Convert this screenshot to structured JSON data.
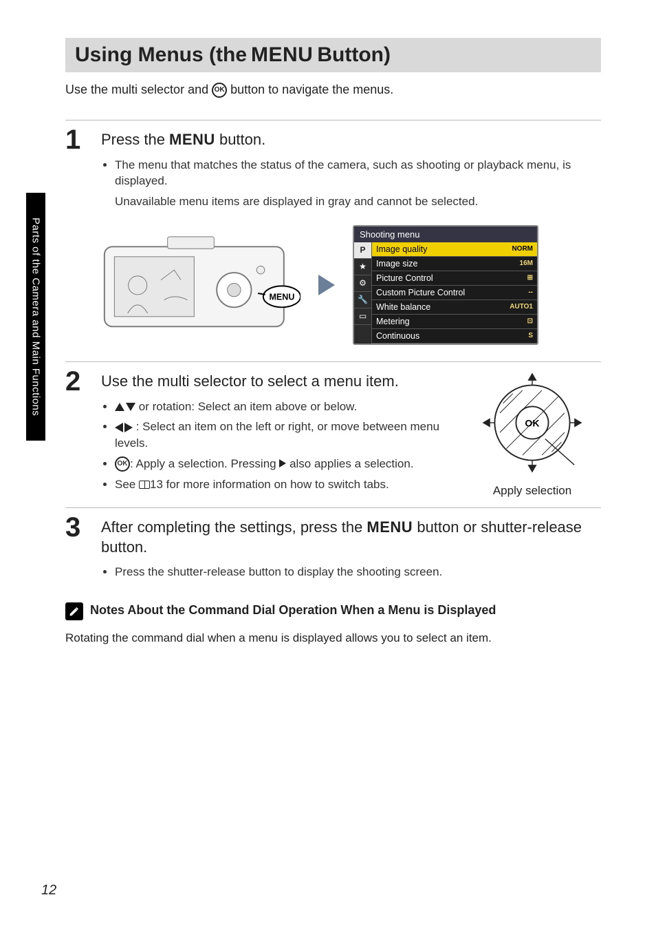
{
  "sideTabLabel": "Parts of the Camera and Main Functions",
  "pageNumber": "12",
  "heading": {
    "pre": "Using Menus (the ",
    "menuWord": "MENU",
    "post": " Button)"
  },
  "intro": {
    "pre": "Use the multi selector and ",
    "ok": "OK",
    "post": " button to navigate the menus."
  },
  "step1": {
    "num": "1",
    "title": {
      "pre": "Press the ",
      "menuWord": "MENU",
      "post": " button."
    },
    "bullets": [
      "The menu that matches the status of the camera, such as shooting or playback menu, is displayed.",
      "Unavailable menu items are displayed in gray and cannot be selected."
    ],
    "cameraMenuLabel": "MENU"
  },
  "menuScreen": {
    "header": "Shooting menu",
    "tabs": [
      "P",
      "★",
      "⚙",
      "🔧",
      "▭"
    ],
    "items": [
      {
        "label": "Image quality",
        "value": "NORM",
        "selected": true
      },
      {
        "label": "Image size",
        "value": "16M"
      },
      {
        "label": "Picture Control",
        "value": "⊞"
      },
      {
        "label": "Custom Picture Control",
        "value": "--"
      },
      {
        "label": "White balance",
        "value": "AUTO1"
      },
      {
        "label": "Metering",
        "value": "⊡"
      },
      {
        "label": "Continuous",
        "value": "S"
      }
    ]
  },
  "step2": {
    "num": "2",
    "title": "Use the multi selector to select a menu item.",
    "bullets": {
      "b1_post": " or rotation: Select an item above or below.",
      "b2_post": ": Select an item on the left or right, or move between menu levels.",
      "b3_pre_ok": "OK",
      "b3_mid": ": Apply a selection. Pressing ",
      "b3_post": " also applies a selection.",
      "b4_pre": "See ",
      "b4_page": "13",
      "b4_post": " for more information on how to switch tabs."
    },
    "selectorOK": "OK",
    "selectorLabel": "Apply selection"
  },
  "step3": {
    "num": "3",
    "title": {
      "pre": "After completing the settings, press the ",
      "menuWord": "MENU",
      "post": " button or shutter-release button."
    },
    "bullet": "Press the shutter-release button to display the shooting screen."
  },
  "notes": {
    "title": "Notes About the Command Dial Operation When a Menu is Displayed",
    "body": "Rotating the command dial when a menu is displayed allows you to select an item."
  }
}
